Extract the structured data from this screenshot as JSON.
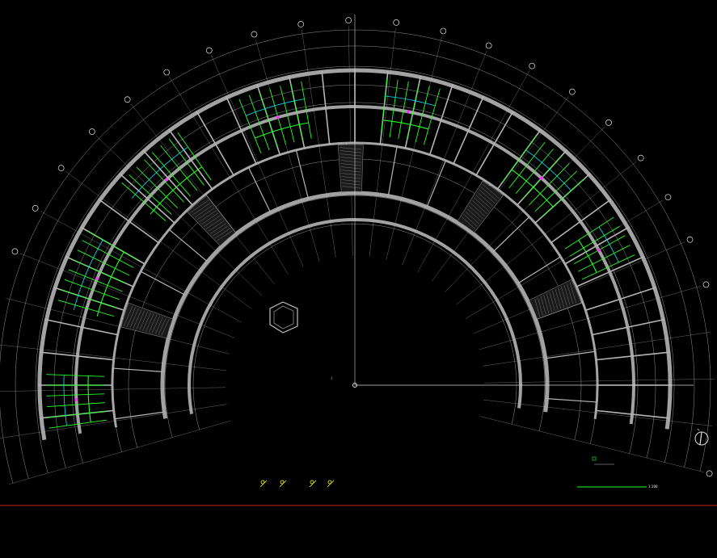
{
  "drawing": {
    "background": "#000000",
    "colors": {
      "wall": "#b4b4b4",
      "grid": "#cfcfcf",
      "axis_bubble": "#e6e6e6",
      "pipe": "#22ff22",
      "fixture": "#00e5ff",
      "valve": "#ff33ff",
      "annotation": "#ffff00",
      "text": "#ffffff",
      "red_rule": "#cc1f1f"
    },
    "center_mark_label": "4",
    "north_arrow_icon": "north-arrow-icon",
    "legend_symbols": [
      {
        "icon": "valve-symbol-icon"
      },
      {
        "icon": "valve-symbol-icon"
      },
      {
        "icon": "valve-symbol-icon"
      },
      {
        "icon": "valve-symbol-icon"
      }
    ],
    "title_block": {
      "caption": "",
      "title": "",
      "scale": "1:100"
    }
  }
}
